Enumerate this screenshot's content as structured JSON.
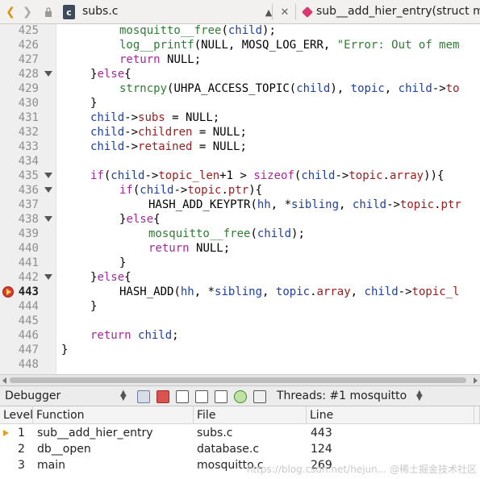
{
  "topbar": {
    "back_icon": "chevron-left-icon",
    "forward_icon": "chevron-right-icon",
    "lock_icon": "lock-icon",
    "file_badge": "c",
    "file_name": "subs.c",
    "function_name": "sub__add_hier_entry(struct mo"
  },
  "editor": {
    "lines": [
      {
        "n": "425",
        "fold": false,
        "bp": false,
        "current": false,
        "indent": 2,
        "tokens": [
          [
            "fn",
            "mosquitto__free"
          ],
          [
            "op",
            "("
          ],
          [
            "var",
            "child"
          ],
          [
            "op",
            ");"
          ]
        ]
      },
      {
        "n": "426",
        "fold": false,
        "bp": false,
        "current": false,
        "indent": 2,
        "tokens": [
          [
            "fn",
            "log__printf"
          ],
          [
            "op",
            "("
          ],
          [
            "nl",
            "NULL"
          ],
          [
            "op",
            ", "
          ],
          [
            "nl",
            "MOSQ_LOG_ERR"
          ],
          [
            "op",
            ", "
          ],
          [
            "str",
            "\"Error: Out of mem"
          ]
        ]
      },
      {
        "n": "427",
        "fold": false,
        "bp": false,
        "current": false,
        "indent": 2,
        "tokens": [
          [
            "kw",
            "return"
          ],
          [
            "op",
            " "
          ],
          [
            "nl",
            "NULL"
          ],
          [
            "op",
            ";"
          ]
        ]
      },
      {
        "n": "428",
        "fold": true,
        "bp": false,
        "current": false,
        "indent": 1,
        "tokens": [
          [
            "op",
            "}"
          ],
          [
            "kw",
            "else"
          ],
          [
            "op",
            "{"
          ]
        ]
      },
      {
        "n": "429",
        "fold": false,
        "bp": false,
        "current": false,
        "indent": 2,
        "tokens": [
          [
            "fn",
            "strncpy"
          ],
          [
            "op",
            "("
          ],
          [
            "nl",
            "UHPA_ACCESS_TOPIC"
          ],
          [
            "op",
            "("
          ],
          [
            "var",
            "child"
          ],
          [
            "op",
            "), "
          ],
          [
            "var",
            "topic"
          ],
          [
            "op",
            ", "
          ],
          [
            "var",
            "child"
          ],
          [
            "op",
            "->"
          ],
          [
            "fld",
            "to"
          ]
        ]
      },
      {
        "n": "430",
        "fold": false,
        "bp": false,
        "current": false,
        "indent": 1,
        "tokens": [
          [
            "op",
            "}"
          ]
        ]
      },
      {
        "n": "431",
        "fold": false,
        "bp": false,
        "current": false,
        "indent": 1,
        "tokens": [
          [
            "var",
            "child"
          ],
          [
            "op",
            "->"
          ],
          [
            "fld",
            "subs"
          ],
          [
            "op",
            " = "
          ],
          [
            "nl",
            "NULL"
          ],
          [
            "op",
            ";"
          ]
        ]
      },
      {
        "n": "432",
        "fold": false,
        "bp": false,
        "current": false,
        "indent": 1,
        "tokens": [
          [
            "var",
            "child"
          ],
          [
            "op",
            "->"
          ],
          [
            "fld",
            "children"
          ],
          [
            "op",
            " = "
          ],
          [
            "nl",
            "NULL"
          ],
          [
            "op",
            ";"
          ]
        ]
      },
      {
        "n": "433",
        "fold": false,
        "bp": false,
        "current": false,
        "indent": 1,
        "tokens": [
          [
            "var",
            "child"
          ],
          [
            "op",
            "->"
          ],
          [
            "fld",
            "retained"
          ],
          [
            "op",
            " = "
          ],
          [
            "nl",
            "NULL"
          ],
          [
            "op",
            ";"
          ]
        ]
      },
      {
        "n": "434",
        "fold": false,
        "bp": false,
        "current": false,
        "indent": 0,
        "tokens": []
      },
      {
        "n": "435",
        "fold": true,
        "bp": false,
        "current": false,
        "indent": 1,
        "tokens": [
          [
            "kw",
            "if"
          ],
          [
            "op",
            "("
          ],
          [
            "var",
            "child"
          ],
          [
            "op",
            "->"
          ],
          [
            "fld",
            "topic_len"
          ],
          [
            "op",
            "+1 > "
          ],
          [
            "kw",
            "sizeof"
          ],
          [
            "op",
            "("
          ],
          [
            "var",
            "child"
          ],
          [
            "op",
            "->"
          ],
          [
            "fld",
            "topic"
          ],
          [
            "op",
            "."
          ],
          [
            "fld",
            "array"
          ],
          [
            "op",
            ")){"
          ]
        ]
      },
      {
        "n": "436",
        "fold": true,
        "bp": false,
        "current": false,
        "indent": 2,
        "tokens": [
          [
            "kw",
            "if"
          ],
          [
            "op",
            "("
          ],
          [
            "var",
            "child"
          ],
          [
            "op",
            "->"
          ],
          [
            "fld",
            "topic"
          ],
          [
            "op",
            "."
          ],
          [
            "fld",
            "ptr"
          ],
          [
            "op",
            "){"
          ]
        ]
      },
      {
        "n": "437",
        "fold": false,
        "bp": false,
        "current": false,
        "indent": 3,
        "tokens": [
          [
            "nl",
            "HASH_ADD_KEYPTR"
          ],
          [
            "op",
            "("
          ],
          [
            "var",
            "hh"
          ],
          [
            "op",
            ", *"
          ],
          [
            "var",
            "sibling"
          ],
          [
            "op",
            ", "
          ],
          [
            "var",
            "child"
          ],
          [
            "op",
            "->"
          ],
          [
            "fld",
            "topic"
          ],
          [
            "op",
            "."
          ],
          [
            "fld",
            "ptr"
          ]
        ]
      },
      {
        "n": "438",
        "fold": true,
        "bp": false,
        "current": false,
        "indent": 2,
        "tokens": [
          [
            "op",
            "}"
          ],
          [
            "kw",
            "else"
          ],
          [
            "op",
            "{"
          ]
        ]
      },
      {
        "n": "439",
        "fold": false,
        "bp": false,
        "current": false,
        "indent": 3,
        "tokens": [
          [
            "fn",
            "mosquitto__free"
          ],
          [
            "op",
            "("
          ],
          [
            "var",
            "child"
          ],
          [
            "op",
            ");"
          ]
        ]
      },
      {
        "n": "440",
        "fold": false,
        "bp": false,
        "current": false,
        "indent": 3,
        "tokens": [
          [
            "kw",
            "return"
          ],
          [
            "op",
            " "
          ],
          [
            "nl",
            "NULL"
          ],
          [
            "op",
            ";"
          ]
        ]
      },
      {
        "n": "441",
        "fold": false,
        "bp": false,
        "current": false,
        "indent": 2,
        "tokens": [
          [
            "op",
            "}"
          ]
        ]
      },
      {
        "n": "442",
        "fold": true,
        "bp": false,
        "current": false,
        "indent": 1,
        "tokens": [
          [
            "op",
            "}"
          ],
          [
            "kw",
            "else"
          ],
          [
            "op",
            "{"
          ]
        ]
      },
      {
        "n": "443",
        "fold": false,
        "bp": true,
        "current": true,
        "indent": 2,
        "tokens": [
          [
            "nl",
            "HASH_ADD"
          ],
          [
            "op",
            "("
          ],
          [
            "var",
            "hh"
          ],
          [
            "op",
            ", *"
          ],
          [
            "var",
            "sibling"
          ],
          [
            "op",
            ", "
          ],
          [
            "var",
            "topic"
          ],
          [
            "op",
            "."
          ],
          [
            "fld",
            "array"
          ],
          [
            "op",
            ", "
          ],
          [
            "var",
            "child"
          ],
          [
            "op",
            "->"
          ],
          [
            "fld",
            "topic_l"
          ]
        ]
      },
      {
        "n": "444",
        "fold": false,
        "bp": false,
        "current": false,
        "indent": 1,
        "tokens": [
          [
            "op",
            "}"
          ]
        ]
      },
      {
        "n": "445",
        "fold": false,
        "bp": false,
        "current": false,
        "indent": 0,
        "tokens": []
      },
      {
        "n": "446",
        "fold": false,
        "bp": false,
        "current": false,
        "indent": 1,
        "tokens": [
          [
            "kw",
            "return"
          ],
          [
            "op",
            " "
          ],
          [
            "var",
            "child"
          ],
          [
            "op",
            ";"
          ]
        ]
      },
      {
        "n": "447",
        "fold": false,
        "bp": false,
        "current": false,
        "indent": 0,
        "tokens": [
          [
            "op",
            "}"
          ]
        ]
      },
      {
        "n": "448",
        "fold": false,
        "bp": false,
        "current": false,
        "indent": 0,
        "tokens": []
      }
    ]
  },
  "debugger": {
    "title": "Debugger",
    "threads_label": "Threads: #1 mosquitto",
    "toolbar_icons": [
      "continue-icon",
      "stop-icon",
      "step-over-icon",
      "step-into-icon",
      "step-out-icon",
      "restart-icon",
      "frame-icon"
    ],
    "columns": [
      "Level",
      "Function",
      "File",
      "Line"
    ],
    "frames": [
      {
        "level": "1",
        "function": "sub__add_hier_entry",
        "file": "subs.c",
        "line": "443",
        "current": true
      },
      {
        "level": "2",
        "function": "db__open",
        "file": "database.c",
        "line": "124",
        "current": false
      },
      {
        "level": "3",
        "function": "main",
        "file": "mosquitto.c",
        "line": "269",
        "current": false
      }
    ]
  },
  "watermark": "https://blog.csdn.net/hejun... @稀土掘金技术社区"
}
